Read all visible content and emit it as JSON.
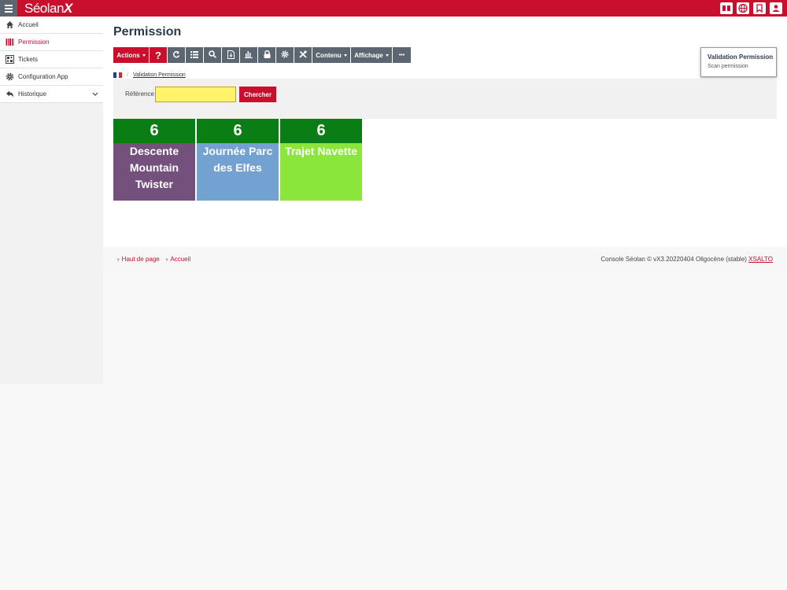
{
  "brand": {
    "name": "Séolan",
    "suffix": "X"
  },
  "sidebar": {
    "items": [
      {
        "label": "Accueil",
        "icon": "home-icon"
      },
      {
        "label": "Permission",
        "icon": "barcode-icon"
      },
      {
        "label": "Tickets",
        "icon": "qr-icon"
      },
      {
        "label": "Configuration App",
        "icon": "gear-icon"
      },
      {
        "label": "Historique",
        "icon": "back-arrow-icon"
      }
    ],
    "active": "Permission"
  },
  "page": {
    "title": "Permission"
  },
  "toolbar": {
    "actions_label": "Actions",
    "help_label": "?",
    "content_label": "Contenu",
    "display_label": "Affichage",
    "more_label": "•••"
  },
  "popover": {
    "title": "Validation Permission",
    "item": "Scan permission"
  },
  "breadcrumb": {
    "link": "Validation Permission"
  },
  "search": {
    "label": "Référence",
    "value": "",
    "button": "Chercher"
  },
  "tiles": [
    {
      "count": "6",
      "label": "Descente Mountain Twister",
      "color": "#74517c"
    },
    {
      "count": "6",
      "label": "Journée Parc des Elfes",
      "color": "#73a1d1"
    },
    {
      "count": "6",
      "label": "Trajet Navette",
      "color": "#8be63c"
    }
  ],
  "footer": {
    "top_link": "Haut de page",
    "home_link": "Accueil",
    "version": "Console Séolan © vX3.20220404 Oligocène (stable)",
    "vendor": "XSALTO"
  },
  "colors": {
    "accent": "#c8102e",
    "count_bar": "#0a7d14",
    "toolbar": "#5b6670"
  }
}
